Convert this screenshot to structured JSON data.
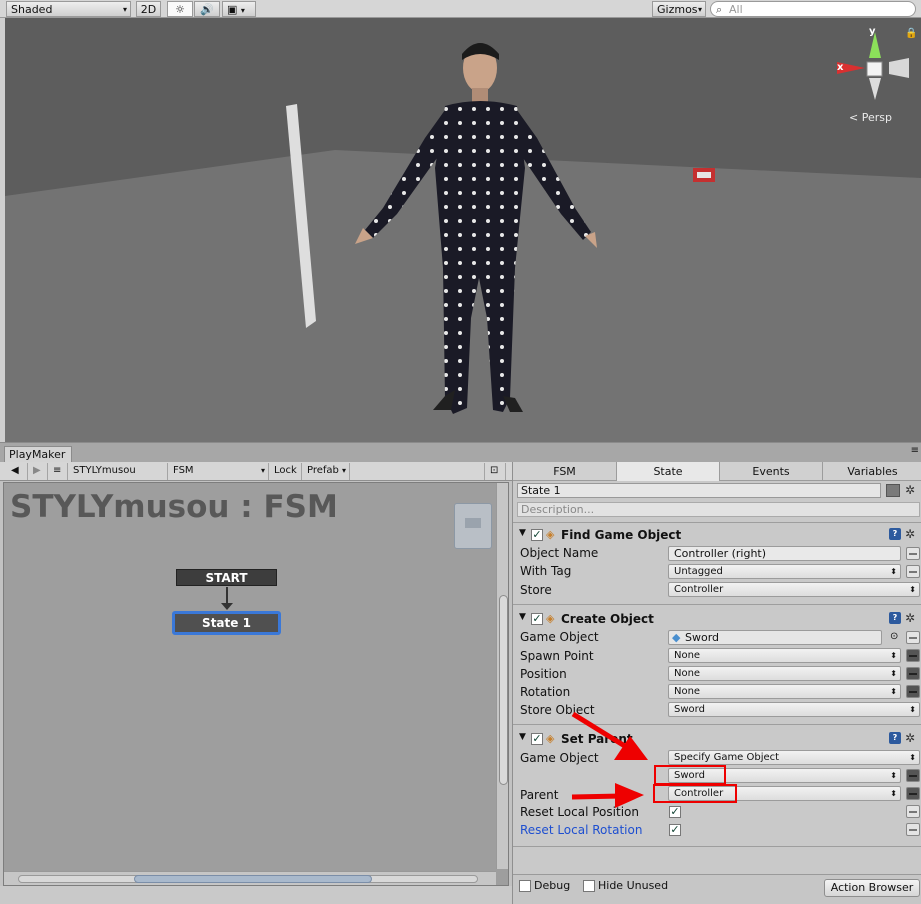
{
  "scene_toolbar": {
    "shading": "Shaded",
    "mode_2d": "2D",
    "gizmos": "Gizmos",
    "search_placeholder": "All"
  },
  "scene": {
    "gizmo_x": "x",
    "gizmo_y": "y",
    "view_mode": "Persp"
  },
  "playmaker": {
    "tab": "PlayMaker",
    "toolbar": {
      "game_object": "STYLYmusou",
      "fsm": "FSM",
      "lock": "Lock",
      "prefab": "Prefab"
    },
    "graph": {
      "title": "STYLYmusou : FSM",
      "start_node": "START",
      "state_node": "State 1"
    }
  },
  "inspector": {
    "tabs": [
      "FSM",
      "State",
      "Events",
      "Variables"
    ],
    "active_tab": "State",
    "state_name": "State 1",
    "description_placeholder": "Description...",
    "actions": [
      {
        "title": "Find Game Object",
        "rows": [
          {
            "label": "Object Name",
            "value": "Controller (right)"
          },
          {
            "label": "With Tag",
            "value": "Untagged"
          },
          {
            "label": "Store",
            "value": "Controller"
          }
        ]
      },
      {
        "title": "Create Object",
        "rows": [
          {
            "label": "Game Object",
            "value": "Sword"
          },
          {
            "label": "Spawn Point",
            "value": "None"
          },
          {
            "label": "Position",
            "value": "None"
          },
          {
            "label": "Rotation",
            "value": "None"
          },
          {
            "label": "Store Object",
            "value": "Sword"
          }
        ]
      },
      {
        "title": "Set Parent",
        "rows": [
          {
            "label": "Game Object",
            "value": "Specify Game Object"
          },
          {
            "label": "",
            "value": "Sword"
          },
          {
            "label": "Parent",
            "value": "Controller"
          },
          {
            "label": "Reset Local Position",
            "value": ""
          },
          {
            "label": "Reset Local Rotation",
            "value": ""
          }
        ]
      }
    ],
    "footer": {
      "debug": "Debug",
      "hide_unused": "Hide Unused",
      "action_browser": "Action Browser"
    }
  },
  "colors": {
    "annotation_red": "#ee0000",
    "selected_state_border": "#3a78d8",
    "link_blue": "#1e4fd0"
  }
}
